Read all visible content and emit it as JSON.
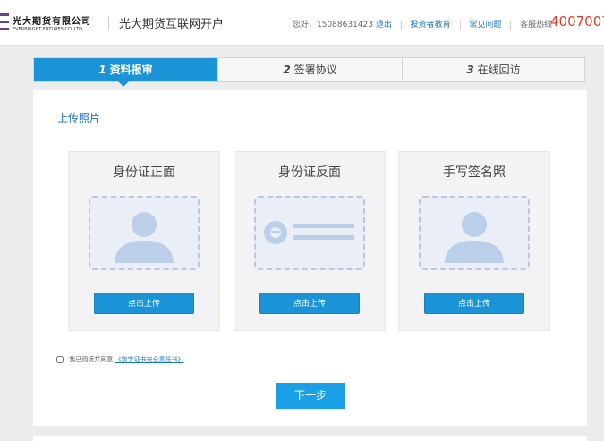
{
  "header": {
    "logo_cn": "光大期货有限公司",
    "logo_en": "EVERBRIGHT FUTURES CO.,LTD.",
    "site_title": "光大期货互联网开户",
    "greeting": "您好，15088631423",
    "logout": "退出",
    "investor_education": "投资者教育",
    "faq": "常见问题",
    "hotline_label": "客服热线",
    "hotline_number": "4007007"
  },
  "steps": [
    {
      "num": "1",
      "label": "资料报审",
      "active": true
    },
    {
      "num": "2",
      "label": "签署协议",
      "active": false
    },
    {
      "num": "3",
      "label": "在线回访",
      "active": false
    }
  ],
  "main": {
    "section_title": "上传照片",
    "cards": [
      {
        "title": "身份证正面",
        "button": "点击上传",
        "icon": "person-silhouette-icon"
      },
      {
        "title": "身份证反面",
        "button": "点击上传",
        "icon": "national-emblem-icon"
      },
      {
        "title": "手写签名照",
        "button": "点击上传",
        "icon": "person-silhouette-icon"
      }
    ],
    "agree_text": "我已阅读并同意",
    "agree_doc": "《数字证书安全责任书》",
    "next_button": "下一步"
  },
  "colors": {
    "primary": "#1a93d7",
    "link": "#1877c4",
    "hotline": "#e83a20",
    "frame_border": "#b9c9e4",
    "silhouette": "#bccfe8"
  }
}
